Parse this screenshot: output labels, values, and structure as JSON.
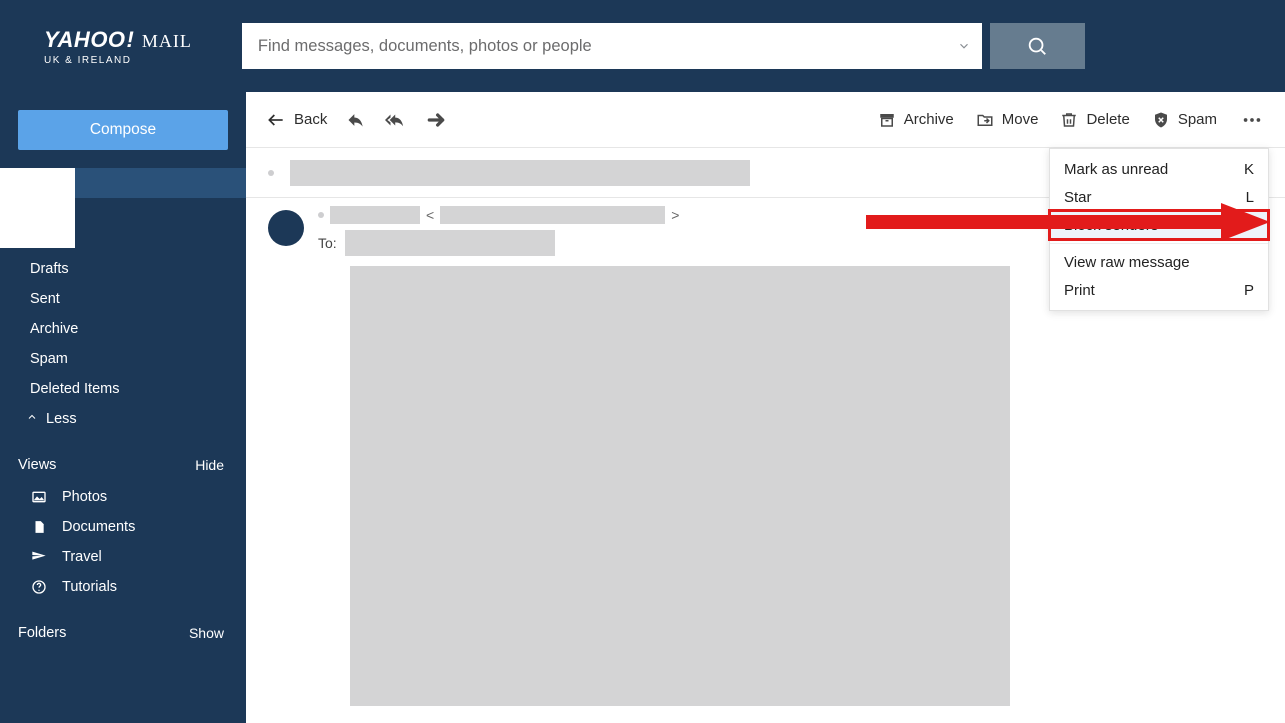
{
  "brand": {
    "name": "YAHOO",
    "excl": "!",
    "product": "MAIL",
    "region": "UK & IRELAND"
  },
  "search": {
    "placeholder": "Find messages, documents, photos or people"
  },
  "sidebar": {
    "compose": "Compose",
    "folders": {
      "drafts": "Drafts",
      "sent": "Sent",
      "archive": "Archive",
      "spam": "Spam",
      "deleted": "Deleted Items",
      "less": "Less"
    },
    "views_header": "Views",
    "views_toggle": "Hide",
    "views": {
      "photos": "Photos",
      "documents": "Documents",
      "travel": "Travel",
      "tutorials": "Tutorials"
    },
    "folders_header": "Folders",
    "folders_toggle": "Show"
  },
  "toolbar": {
    "back": "Back",
    "archive": "Archive",
    "move": "Move",
    "delete": "Delete",
    "spam": "Spam"
  },
  "message": {
    "to_label": "To:",
    "angle_open": "<",
    "angle_close": ">"
  },
  "more_menu": {
    "mark_unread": {
      "label": "Mark as unread",
      "shortcut": "K"
    },
    "star": {
      "label": "Star",
      "shortcut": "L"
    },
    "block": {
      "label": "Block senders",
      "shortcut": ""
    },
    "view_raw": {
      "label": "View raw message",
      "shortcut": ""
    },
    "print": {
      "label": "Print",
      "shortcut": "P"
    }
  }
}
